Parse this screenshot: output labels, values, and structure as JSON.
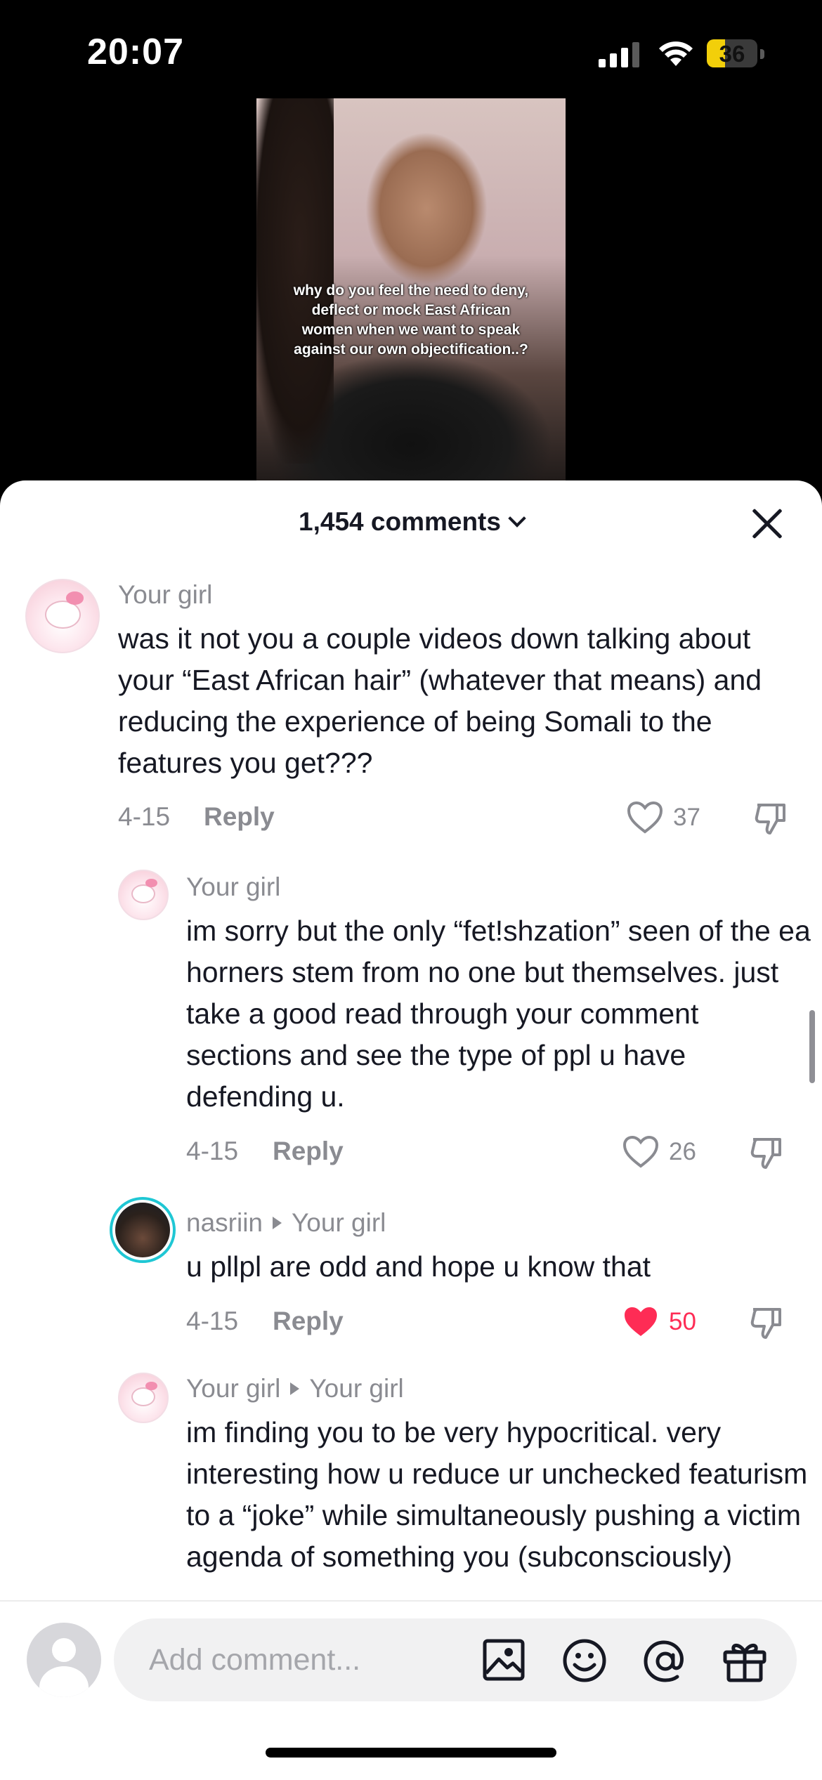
{
  "status_bar": {
    "time": "20:07",
    "battery": "36",
    "battery_level": 0.36
  },
  "video": {
    "caption": "why do you feel the need to deny, deflect or mock East African women when we want to speak against our own objectification..?"
  },
  "sheet": {
    "comments_count": "1,454 comments"
  },
  "comments": [
    {
      "username": "Your girl",
      "text": "was it not you a couple videos down talking about your “East African hair” (whatever that means) and reducing the experience of being Somali to the features you get???",
      "date": "4-15",
      "reply_label": "Reply",
      "likes": "37",
      "liked": false
    },
    {
      "username": "Your girl",
      "text": "im sorry but the only “fet!shzation” seen of the ea horners stem from no one but themselves. just take a good read through your comment sections and see the type of ppl u have defending u.",
      "date": "4-15",
      "reply_label": "Reply",
      "likes": "26",
      "liked": false
    },
    {
      "username": "nasriin",
      "reply_to": "Your girl",
      "text": "u pllpl are odd and hope u know that",
      "date": "4-15",
      "reply_label": "Reply",
      "likes": "50",
      "liked": true
    },
    {
      "username": "Your girl",
      "reply_to": "Your girl",
      "text": "im finding you to be very hypocritical. very interesting how u reduce ur unchecked featurism to a “joke” while simultaneously pushing a victim agenda of something you (subconsciously)"
    }
  ],
  "composer": {
    "placeholder": "Add comment..."
  },
  "icons": [
    "signal-icon",
    "wifi-icon",
    "battery-icon",
    "chevron-down-icon",
    "close-icon",
    "heart-icon",
    "dislike-icon",
    "image-icon",
    "emoji-icon",
    "mention-icon",
    "gift-icon"
  ],
  "colors": {
    "liked_heart": "#fe2c55",
    "muted_text": "#8a8b91",
    "ring_accent": "#1fc7d4"
  }
}
